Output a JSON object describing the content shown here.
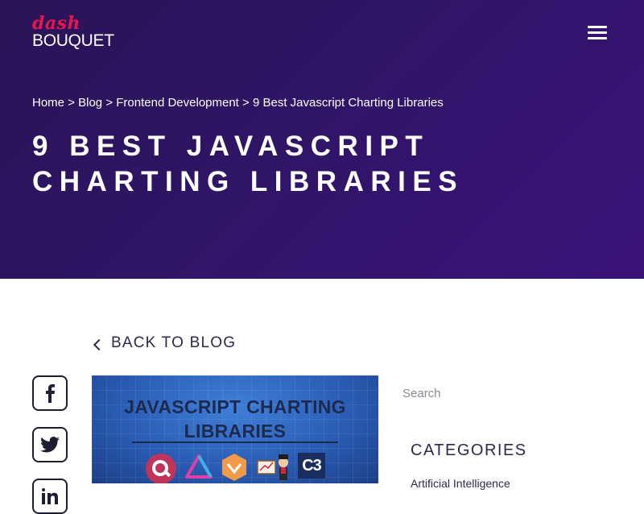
{
  "header": {
    "logo": {
      "top": "dash",
      "bottom": "BOUQUET"
    },
    "menu_icon": "hamburger-menu-icon"
  },
  "breadcrumb": {
    "items": [
      "Home",
      "Blog",
      "Frontend Development",
      "9 Best Javascript Charting Libraries"
    ],
    "separator": ">"
  },
  "page": {
    "title_line1": "9 BEST JAVASCRIPT",
    "title_line2": "CHARTING LIBRARIES",
    "back_label": "BACK TO BLOG"
  },
  "social": [
    {
      "icon": "facebook-icon"
    },
    {
      "icon": "twitter-icon"
    },
    {
      "icon": "linkedin-icon"
    }
  ],
  "feature_image": {
    "line1": "JAVASCRIPT CHARTING",
    "line2": "LIBRARIES",
    "logo_c3": "C3"
  },
  "sidebar": {
    "search_placeholder": "Search",
    "categories_title": "CATEGORIES",
    "categories": [
      "Artificial Intelligence"
    ]
  },
  "colors": {
    "hero_bg": "#2f1566",
    "brand_red": "#e8164f",
    "text_dark": "#2a2a4a"
  }
}
